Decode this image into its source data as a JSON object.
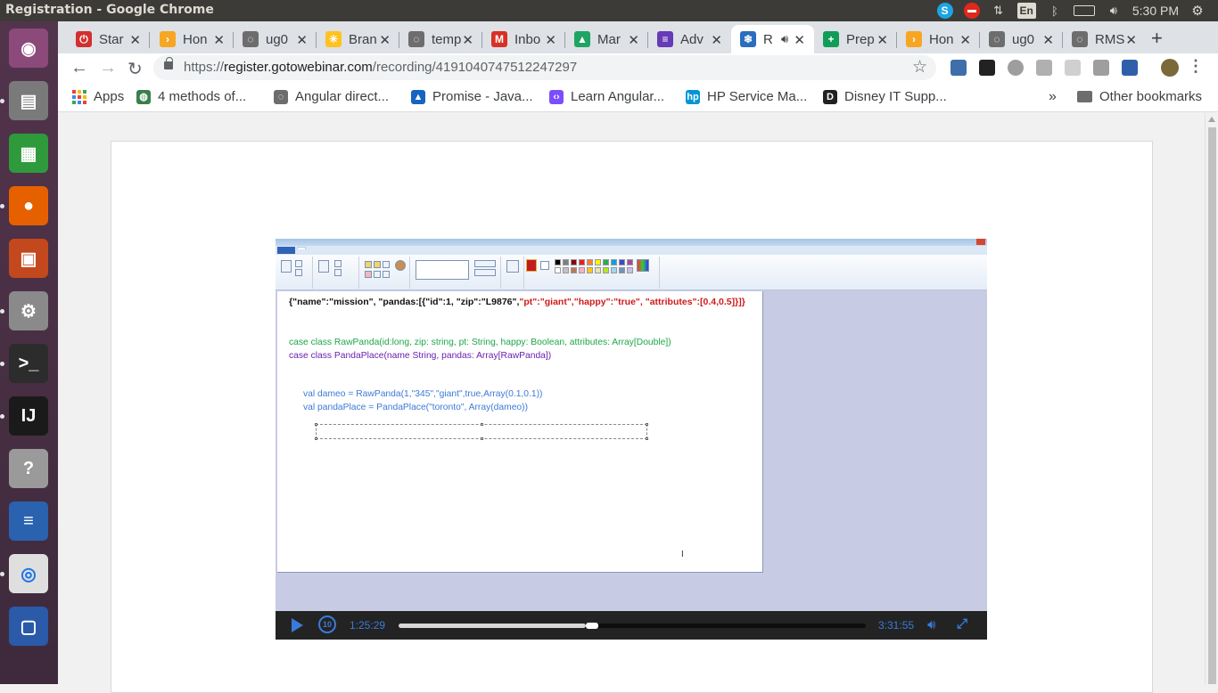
{
  "window": {
    "title": "Registration - Google Chrome"
  },
  "panel": {
    "lang": "En",
    "clock": "5:30 PM",
    "skype": "S"
  },
  "launcher": {
    "items": [
      {
        "name": "ubuntu-dash",
        "color": "#8b4a7a",
        "glyph": "◉"
      },
      {
        "name": "files",
        "color": "#7a7a7a",
        "glyph": "▤"
      },
      {
        "name": "libreoffice-calc",
        "color": "#2e9a3c",
        "glyph": "▦"
      },
      {
        "name": "firefox",
        "color": "#e66000",
        "glyph": "●"
      },
      {
        "name": "libreoffice-impress",
        "color": "#c4481d",
        "glyph": "▣"
      },
      {
        "name": "system-settings",
        "color": "#8a8a8a",
        "glyph": "⚙"
      },
      {
        "name": "terminal",
        "color": "#2c2c2c",
        "glyph": ">_"
      },
      {
        "name": "intellij-idea",
        "color": "#1a1a1a",
        "glyph": "IJ"
      },
      {
        "name": "help",
        "color": "#9a9a9a",
        "glyph": "?"
      },
      {
        "name": "libreoffice-writer",
        "color": "#2a62b0",
        "glyph": "≡"
      },
      {
        "name": "chrome",
        "color": "#dfdfdf",
        "glyph": "◎"
      },
      {
        "name": "virtualbox",
        "color": "#2a5aa8",
        "glyph": "▢"
      }
    ]
  },
  "tabs": [
    {
      "label": "Star",
      "color": "#d32f2f",
      "glyph": "⏻"
    },
    {
      "label": "Hon",
      "color": "#f6a623",
      "glyph": "›"
    },
    {
      "label": "ug0",
      "color": "#6d6d6d",
      "glyph": "◌"
    },
    {
      "label": "Bran",
      "color": "#ffc220",
      "glyph": "✳"
    },
    {
      "label": "temp",
      "color": "#6d6d6d",
      "glyph": "◌"
    },
    {
      "label": "Inbo",
      "color": "#d93025",
      "glyph": "M"
    },
    {
      "label": "Mar",
      "color": "#1fa463",
      "glyph": "▲"
    },
    {
      "label": "Adv",
      "color": "#673ab7",
      "glyph": "≡"
    },
    {
      "label": "R",
      "color": "#2b6dbf",
      "glyph": "❄",
      "active": true
    },
    {
      "label": "Prep",
      "color": "#0f9d58",
      "glyph": "+"
    },
    {
      "label": "Hon",
      "color": "#f6a623",
      "glyph": "›"
    },
    {
      "label": "ug0",
      "color": "#6d6d6d",
      "glyph": "◌"
    },
    {
      "label": "RMS",
      "color": "#6d6d6d",
      "glyph": "◌"
    }
  ],
  "omnibox": {
    "scheme": "https://",
    "host": "register.gotowebinar.com",
    "path": "/recording/4191040747512247297"
  },
  "bookmarks": {
    "apps": "Apps",
    "items": [
      {
        "label": "4 methods of...",
        "color": "#3a7f4a",
        "glyph": "◍"
      },
      {
        "label": "Angular direct...",
        "color": "#6d6d6d",
        "glyph": "◌"
      },
      {
        "label": "Promise - Java...",
        "color": "#1565c0",
        "glyph": "▲"
      },
      {
        "label": "Learn Angular...",
        "color": "#7c4dff",
        "glyph": "‹›"
      },
      {
        "label": "HP Service Ma...",
        "color": "#0096d6",
        "glyph": "hp"
      },
      {
        "label": "Disney IT Supp...",
        "color": "#222222",
        "glyph": "D"
      }
    ],
    "more": "»",
    "other": "Other bookmarks"
  },
  "paint": {
    "line_json_prefix": "{\"name\":\"mission\", \"pandas:[{\"id\":1, \"zip\":\"L9876\",",
    "line_json_red": "\"pt\":\"giant\",\"happy\":\"true\",  \"attributes\":[0.4,0.5]}]}",
    "line_raw_panda": "case class RawPanda(id:long, zip: string, pt: String, happy: Boolean, attributes: Array[Double])",
    "line_panda_place": "case class PandaPlace(name String, pandas: Array[RawPanda])",
    "line_dameo": "val dameo = RawPanda(1,\"345\",\"giant\",true,Array(0.1,0.1))",
    "line_panda_place_val": "val pandaPlace = PandaPlace(\"toronto\", Array(dameo))",
    "swatches": [
      "#000000",
      "#7f7f7f",
      "#880015",
      "#ed1c24",
      "#ff7f27",
      "#fff200",
      "#22b14c",
      "#00a2e8",
      "#3f48cc",
      "#a349a4",
      "#ffffff",
      "#c3c3c3",
      "#b97a57",
      "#ffaec9",
      "#ffc90e",
      "#efe4b0",
      "#b5e61d",
      "#99d9ea",
      "#7092be",
      "#c8bfe7"
    ]
  },
  "player": {
    "current_time": "1:25:29",
    "duration": "3:31:55",
    "progress_fraction": 0.4,
    "rewind_label": "10"
  }
}
